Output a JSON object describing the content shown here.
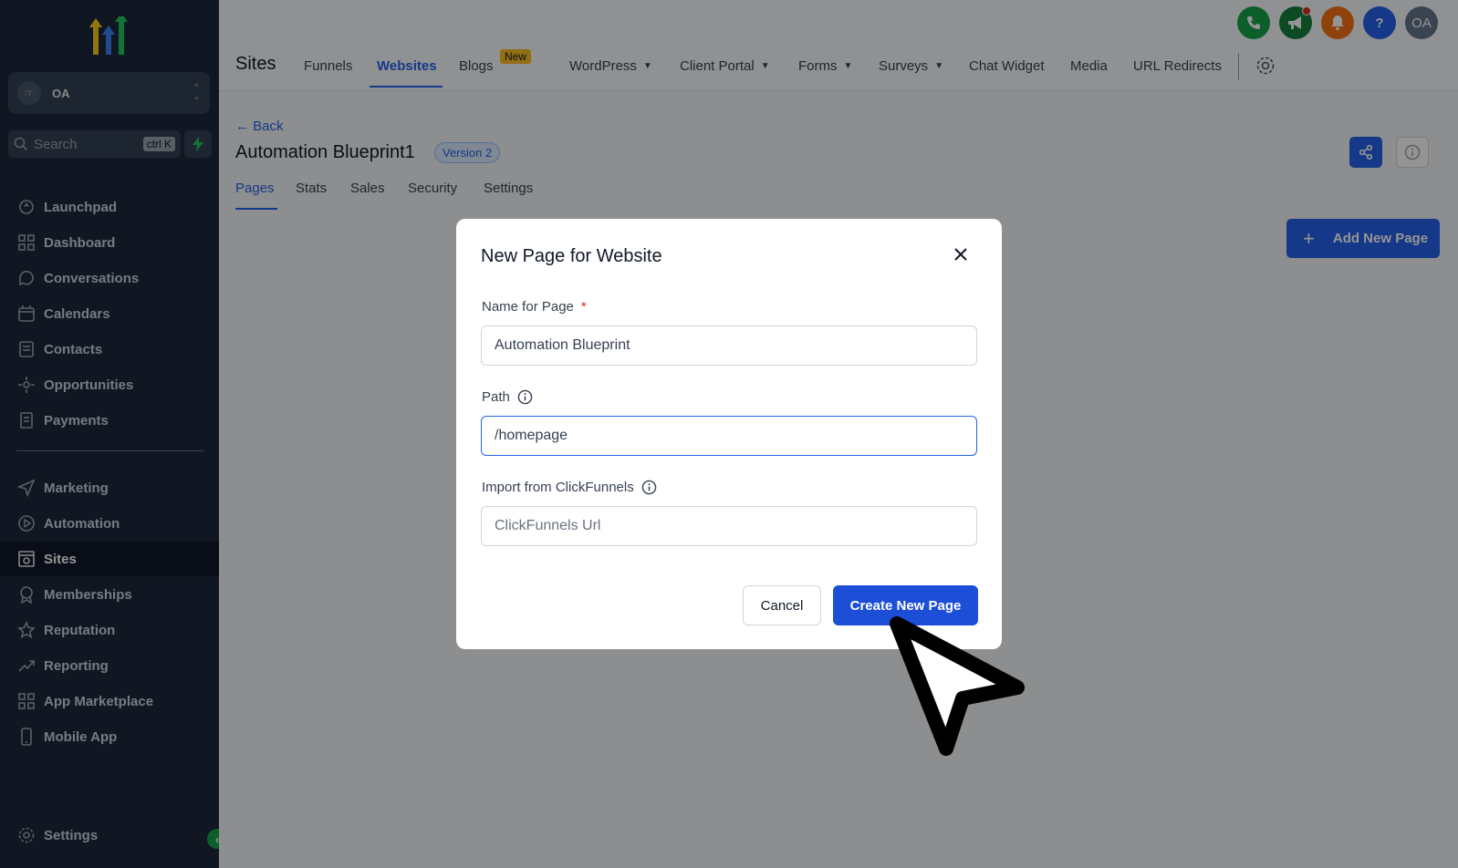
{
  "sidebar": {
    "account": {
      "name": "OA"
    },
    "search": {
      "label": "Search",
      "shortcut": "ctrl K"
    },
    "items": [
      {
        "label": "Launchpad",
        "icon": "rocket-icon"
      },
      {
        "label": "Dashboard",
        "icon": "grid-icon"
      },
      {
        "label": "Conversations",
        "icon": "chat-icon"
      },
      {
        "label": "Calendars",
        "icon": "calendar-icon"
      },
      {
        "label": "Contacts",
        "icon": "contacts-icon"
      },
      {
        "label": "Opportunities",
        "icon": "opportunities-icon"
      },
      {
        "label": "Payments",
        "icon": "payments-icon"
      },
      {
        "label": "Marketing",
        "icon": "send-icon"
      },
      {
        "label": "Automation",
        "icon": "automation-icon"
      },
      {
        "label": "Sites",
        "icon": "sites-icon"
      },
      {
        "label": "Memberships",
        "icon": "badge-icon"
      },
      {
        "label": "Reputation",
        "icon": "star-icon"
      },
      {
        "label": "Reporting",
        "icon": "trend-icon"
      },
      {
        "label": "App Marketplace",
        "icon": "apps-icon"
      },
      {
        "label": "Mobile App",
        "icon": "mobile-icon"
      }
    ],
    "settings_label": "Settings",
    "active_item": "Sites"
  },
  "header": {
    "section_title": "Sites",
    "nav": [
      {
        "label": "Funnels"
      },
      {
        "label": "Websites"
      },
      {
        "label": "Blogs",
        "badge": "New"
      },
      {
        "label": "WordPress"
      },
      {
        "label": "Client Portal"
      },
      {
        "label": "Forms"
      },
      {
        "label": "Surveys"
      },
      {
        "label": "Chat Widget"
      },
      {
        "label": "Media"
      },
      {
        "label": "URL Redirects"
      }
    ],
    "active_nav": "Websites",
    "avatar_initials": "OA",
    "icon_colors": {
      "phone": "#16a34a",
      "announce": "#15803d",
      "bell": "#f97316",
      "help": "#2563eb",
      "avatar": "#64748b"
    }
  },
  "page": {
    "back_label": "Back",
    "site_name": "Automation Blueprint1",
    "version_badge": "Version 2",
    "tabs": [
      {
        "label": "Pages"
      },
      {
        "label": "Stats"
      },
      {
        "label": "Sales"
      },
      {
        "label": "Security"
      },
      {
        "label": "Settings"
      }
    ],
    "active_tab": "Pages",
    "add_page_label": "Add New Page"
  },
  "modal": {
    "title": "New Page for Website",
    "name_label": "Name for Page",
    "required_mark": "*",
    "name_value": "Automation Blueprint",
    "path_label": "Path",
    "path_value": "/homepage",
    "import_label": "Import from ClickFunnels",
    "import_placeholder": "ClickFunnels Url",
    "cancel_label": "Cancel",
    "create_label": "Create New Page"
  },
  "colors": {
    "accent": "#2563eb",
    "sidebar_bg": "#1e293b"
  }
}
